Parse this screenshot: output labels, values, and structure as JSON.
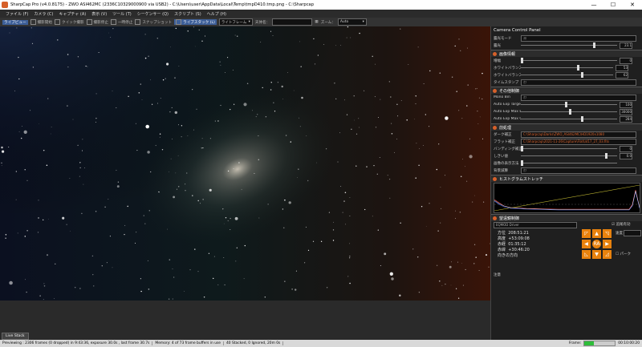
{
  "window": {
    "title": "SharpCap Pro (v4.0.8175) - ZWO ASI462MC (2336C10329000900 via USB2) - C:\\Users\\user\\AppData\\Local\\Temp\\tmpD410.tmp.png - C:\\Sharpcap",
    "buttons": {
      "minimize": "—",
      "maximize": "☐",
      "close": "✕"
    }
  },
  "menu": [
    "ファイル (F)",
    "カメラ (C)",
    "キャプチャ (A)",
    "表示 (V)",
    "ツール (T)",
    "シーケンサー (Q)",
    "スクリプト (S)",
    "ヘルプ (H)"
  ],
  "toolbar": {
    "items": [
      {
        "label": "ライブビュー",
        "active": true
      },
      {
        "label": "撮影開始",
        "active": false
      },
      {
        "label": "クイック撮影",
        "active": false
      },
      {
        "label": "撮影停止",
        "active": false
      },
      {
        "label": "一時停止",
        "active": false
      },
      {
        "label": "スナップショット",
        "active": false
      },
      {
        "label": "ライブスタック (L)",
        "active": true
      }
    ],
    "frame_select": "ライトフレーム",
    "pretype_label": "天体名：",
    "grid_label": "▦",
    "zoom_label": "ズーム：",
    "zoom_value": "Auto"
  },
  "camera_panel": {
    "title": "Camera Control Panel",
    "top_rows": [
      {
        "label": "露光モード",
        "value": "ｽﾛ"
      },
      {
        "label": "露光",
        "value": "23.1"
      }
    ],
    "sections": [
      {
        "name": "画像情報",
        "rows": [
          {
            "label": "増幅",
            "value": "0"
          },
          {
            "label": "ホワイトバランス(赤)",
            "value": "53"
          },
          {
            "label": "ホワイトバランス(青)",
            "value": "62"
          },
          {
            "label": "タイムスタンプ",
            "value": "ｵﾌ"
          }
        ]
      },
      {
        "name": "その他制御",
        "rows": [
          {
            "label": "Mono Bin",
            "value": "ｵﾌ"
          },
          {
            "label": "Auto Exp Target Brightness",
            "value": "100"
          },
          {
            "label": "Auto Exp Max Exp M S",
            "value": "30000"
          },
          {
            "label": "Auto Exp Max Gain",
            "value": "284"
          }
        ]
      },
      {
        "name": "前処理",
        "rows": [
          {
            "label": "ダーク補正",
            "value": "C:\\Sharpcap\\Darks\\ZWO_ASI462MC\\HD1920x1080"
          },
          {
            "label": "フラット補正",
            "value": "C:\\Sharpcap\\2021-11-26\\Capture\\Flat\\at17_27_03.fits"
          },
          {
            "label": "バンディング補正",
            "value": "0"
          },
          {
            "label": "しきい値",
            "value": "0.0"
          },
          {
            "label": "画像の表示方法",
            "value": ""
          },
          {
            "label": "背景減算",
            "value": "ｵﾌ"
          }
        ]
      },
      {
        "name": "ヒストグラムストレッチ",
        "rows": []
      },
      {
        "name": "望遠鏡制御",
        "rows": []
      }
    ],
    "mount": {
      "name": "EQMOD Driver",
      "tracking_label": "追尾有効",
      "coords": [
        {
          "label": "方位",
          "value": "208:51:21"
        },
        {
          "label": "高度",
          "value": "+53:09:08"
        },
        {
          "label": "赤経",
          "value": "01:35:12"
        },
        {
          "label": "赤緯",
          "value": "+30:46:20"
        }
      ],
      "pier_label": "向きの方向",
      "rate_label": "速度：",
      "park_label": "パーク",
      "center_label": "RA",
      "notes_label": "注意"
    }
  },
  "live_stack_tab": "Live Stack",
  "status": {
    "preview": "Previewing : 2306 frames (0 dropped) in 9:43:36, exposure 30.0s , last frame 30.7s",
    "memory": "Memory: 4 of 73 frame buffers in use",
    "stacked": "40 Stacked, 0 Ignored, 20m 0s",
    "frame_label": "Frame:",
    "timer": "00:10:00:20"
  },
  "colors": {
    "accent": "#d6602a",
    "orange_button": "#e8820e",
    "toolbar_active": "#3d5f99"
  }
}
